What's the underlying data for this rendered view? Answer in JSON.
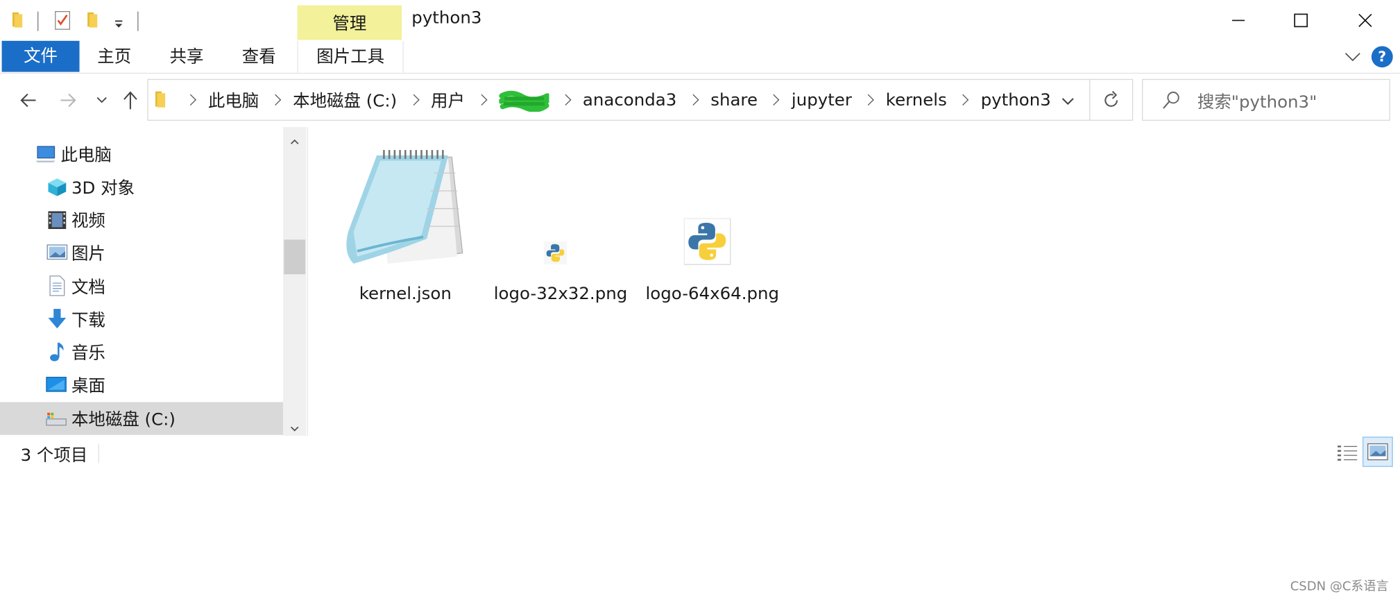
{
  "window": {
    "title": "python3",
    "manage_tab": "管理",
    "controls": {
      "minimize": "minimize",
      "maximize": "maximize",
      "close": "close"
    }
  },
  "ribbon": {
    "file_tab": "文件",
    "tabs": [
      "主页",
      "共享",
      "查看"
    ],
    "tools_tab": "图片工具",
    "help": "?"
  },
  "address": {
    "crumbs": [
      "此电脑",
      "本地磁盘 (C:)",
      "用户",
      "",
      "anaconda3",
      "share",
      "jupyter",
      "kernels",
      "python3"
    ]
  },
  "search": {
    "placeholder": "搜索\"python3\""
  },
  "sidebar": {
    "items": [
      {
        "label": "此电脑",
        "icon": "computer-icon"
      },
      {
        "label": "3D 对象",
        "icon": "cube-3d-icon"
      },
      {
        "label": "视频",
        "icon": "video-icon"
      },
      {
        "label": "图片",
        "icon": "picture-icon"
      },
      {
        "label": "文档",
        "icon": "document-icon"
      },
      {
        "label": "下载",
        "icon": "download-icon"
      },
      {
        "label": "音乐",
        "icon": "music-icon"
      },
      {
        "label": "桌面",
        "icon": "desktop-icon"
      },
      {
        "label": "本地磁盘 (C:)",
        "icon": "drive-icon"
      }
    ]
  },
  "files": [
    {
      "name": "kernel.json",
      "icon": "notepad-icon"
    },
    {
      "name": "logo-32x32.png",
      "icon": "python-logo-small-icon"
    },
    {
      "name": "logo-64x64.png",
      "icon": "python-logo-large-icon"
    }
  ],
  "status": {
    "count": "3 个项目"
  },
  "watermark": "CSDN @C系语言",
  "colors": {
    "file_tab": "#1a6ec7",
    "manage_tab": "#f3f19a",
    "selected": "#d9d9d9",
    "help": "#1a6ec7"
  }
}
